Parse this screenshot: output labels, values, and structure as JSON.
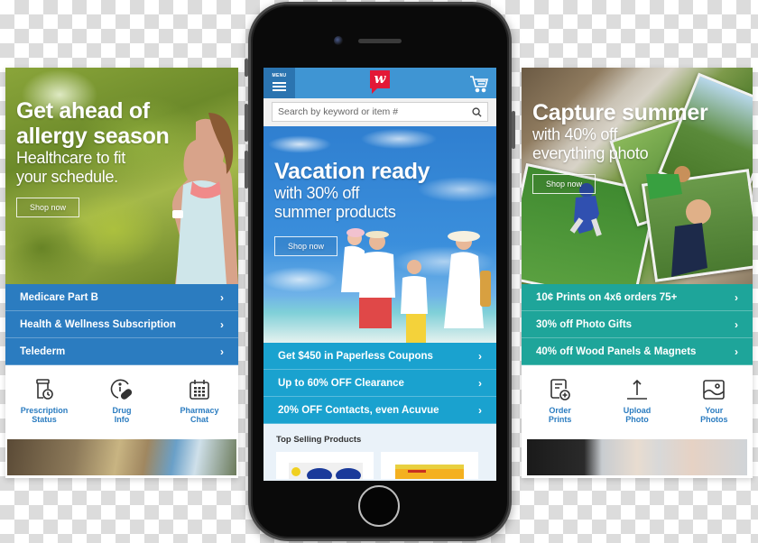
{
  "left_panel": {
    "hero": {
      "title_line1": "Get ahead of",
      "title_line2": "allergy season",
      "subtitle_line1": "Healthcare to fit",
      "subtitle_line2": "your schedule.",
      "cta": "Shop now"
    },
    "promos": [
      {
        "label": "Medicare Part B",
        "chevron": "›"
      },
      {
        "label": "Health & Wellness Subscription",
        "chevron": "›"
      },
      {
        "label": "Telederm",
        "chevron": "›"
      }
    ],
    "quick_links": [
      {
        "icon": "prescription-bottle-clock-icon",
        "line1": "Prescription",
        "line2": "Status"
      },
      {
        "icon": "info-pill-icon",
        "line1": "Drug",
        "line2": "Info"
      },
      {
        "icon": "calendar-icon",
        "line1": "Pharmacy",
        "line2": "Chat"
      }
    ],
    "accent_color": "#2b7cc0"
  },
  "phone": {
    "header": {
      "menu_label": "MENU",
      "logo_letter": "w",
      "logo_color": "#e31837",
      "cart_icon": "shopping-cart-icon"
    },
    "search": {
      "placeholder": "Search by keyword or item #",
      "icon": "search-icon"
    },
    "hero": {
      "title": "Vacation ready",
      "subtitle_line1": "with 30% off",
      "subtitle_line2": "summer products",
      "cta": "Shop now"
    },
    "promos": [
      {
        "label": "Get $450 in Paperless Coupons",
        "chevron": "›"
      },
      {
        "label": "Up to 60% OFF Clearance",
        "chevron": "›"
      },
      {
        "label": "20% OFF Contacts, even Acuvue",
        "chevron": "›"
      }
    ],
    "top_selling": {
      "title": "Top Selling Products"
    },
    "accent_color": "#1aa2cf"
  },
  "right_panel": {
    "hero": {
      "title": "Capture summer",
      "subtitle_line1": "with 40% off",
      "subtitle_line2": "everything photo",
      "cta": "Shop now"
    },
    "promos": [
      {
        "label": "10¢ Prints on 4x6 orders 75+",
        "chevron": "›"
      },
      {
        "label": "30% off Photo Gifts",
        "chevron": "›"
      },
      {
        "label": "40% off Wood Panels & Magnets",
        "chevron": "›"
      }
    ],
    "quick_links": [
      {
        "icon": "order-prints-icon",
        "line1": "Order",
        "line2": "Prints"
      },
      {
        "icon": "upload-icon",
        "line1": "Upload",
        "line2": "Photo"
      },
      {
        "icon": "image-icon",
        "line1": "Your",
        "line2": "Photos"
      }
    ],
    "accent_color": "#1ea59a"
  }
}
